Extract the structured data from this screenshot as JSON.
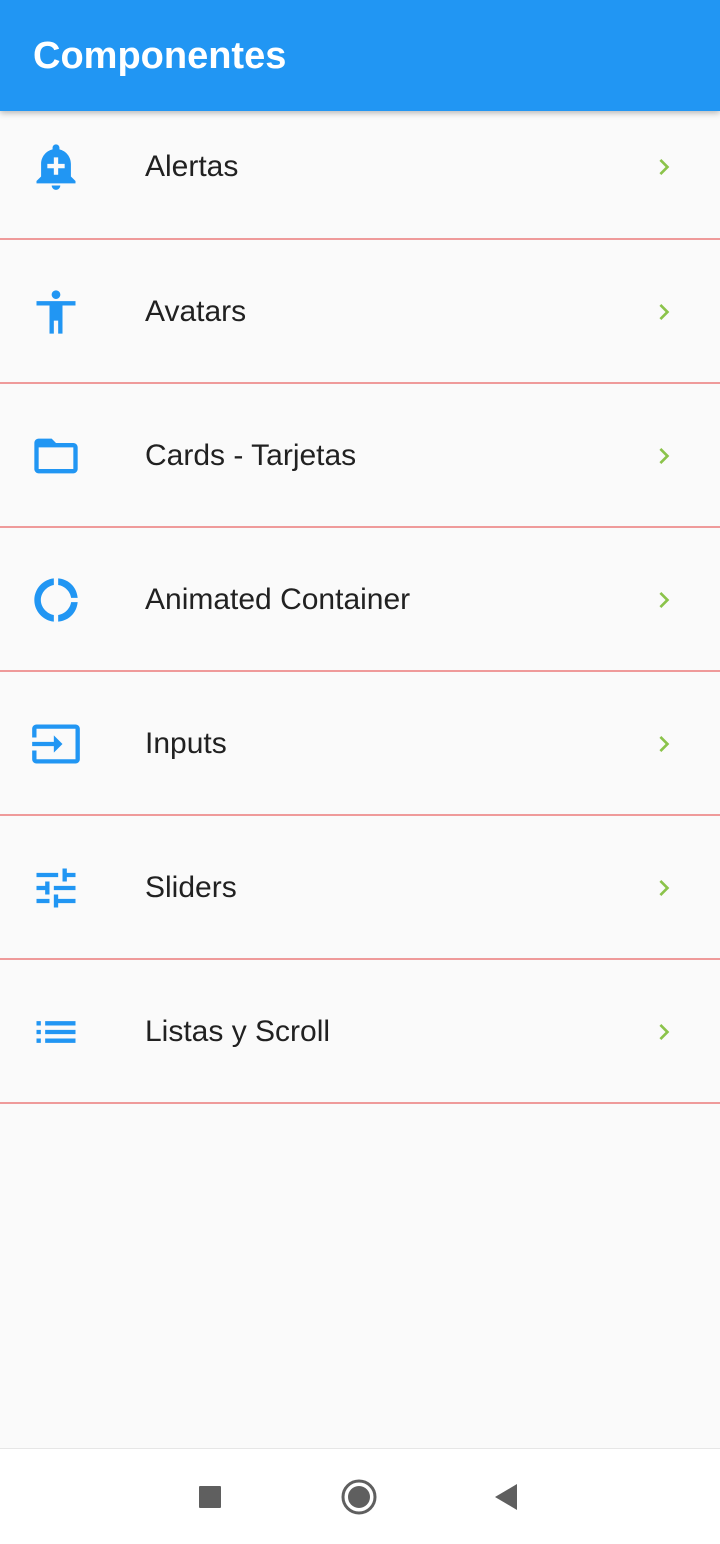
{
  "appbar": {
    "title": "Componentes",
    "background_color": "#2196F3"
  },
  "menu": {
    "icon_color": "#2196F3",
    "chevron_color": "#8BC34A",
    "divider_color": "#EF9A9A",
    "items": [
      {
        "label": "Alertas",
        "icon": "add-alert-icon"
      },
      {
        "label": "Avatars",
        "icon": "accessibility-icon"
      },
      {
        "label": "Cards - Tarjetas",
        "icon": "folder-open-icon"
      },
      {
        "label": "Animated Container",
        "icon": "donut-large-icon"
      },
      {
        "label": "Inputs",
        "icon": "input-icon"
      },
      {
        "label": "Sliders",
        "icon": "tune-icon"
      },
      {
        "label": "Listas y Scroll",
        "icon": "list-icon"
      }
    ]
  },
  "system_nav": {
    "buttons": [
      {
        "icon": "recents-square-icon"
      },
      {
        "icon": "home-circle-icon"
      },
      {
        "icon": "back-triangle-icon"
      }
    ]
  }
}
